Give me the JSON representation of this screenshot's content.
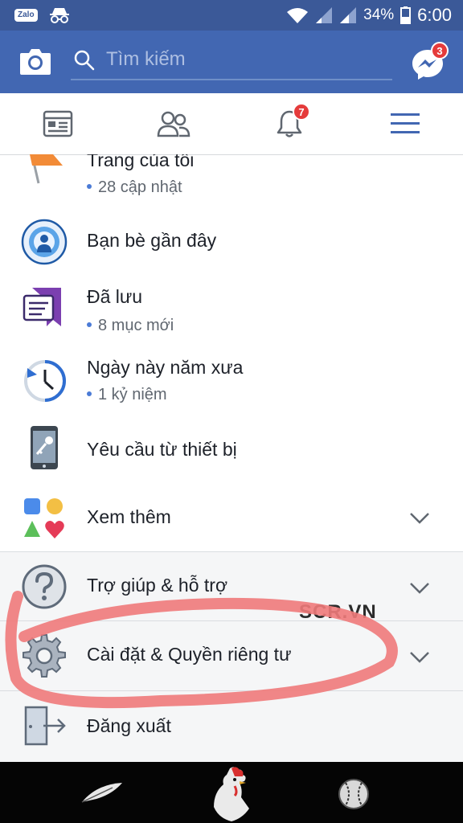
{
  "status_bar": {
    "app_badge": "Zalo",
    "battery": "34%",
    "time": "6:00"
  },
  "top_bar": {
    "search_placeholder": "Tìm kiếm",
    "messenger_badge": "3"
  },
  "nav": {
    "notifications_badge": "7"
  },
  "menu": {
    "my_page": {
      "title": "Trang của tôi",
      "sub": "28 cập nhật"
    },
    "nearby_friends": {
      "title": "Bạn bè gần đây"
    },
    "saved": {
      "title": "Đã lưu",
      "sub": "8 mục mới"
    },
    "memories": {
      "title": "Ngày này năm xưa",
      "sub": "1 kỷ niệm"
    },
    "device_requests": {
      "title": "Yêu cầu từ thiết bị"
    },
    "see_more": {
      "title": "Xem thêm"
    },
    "help": {
      "title": "Trợ giúp & hỗ trợ"
    },
    "settings": {
      "title": "Cài đặt & Quyền riêng tư"
    },
    "logout": {
      "title": "Đăng xuất"
    }
  },
  "watermark": "SCR.VN",
  "colors": {
    "brand_blue": "#4267b2",
    "status_blue": "#3b5998",
    "badge_red": "#e53b3b",
    "annotation_red": "#f07a7a"
  }
}
